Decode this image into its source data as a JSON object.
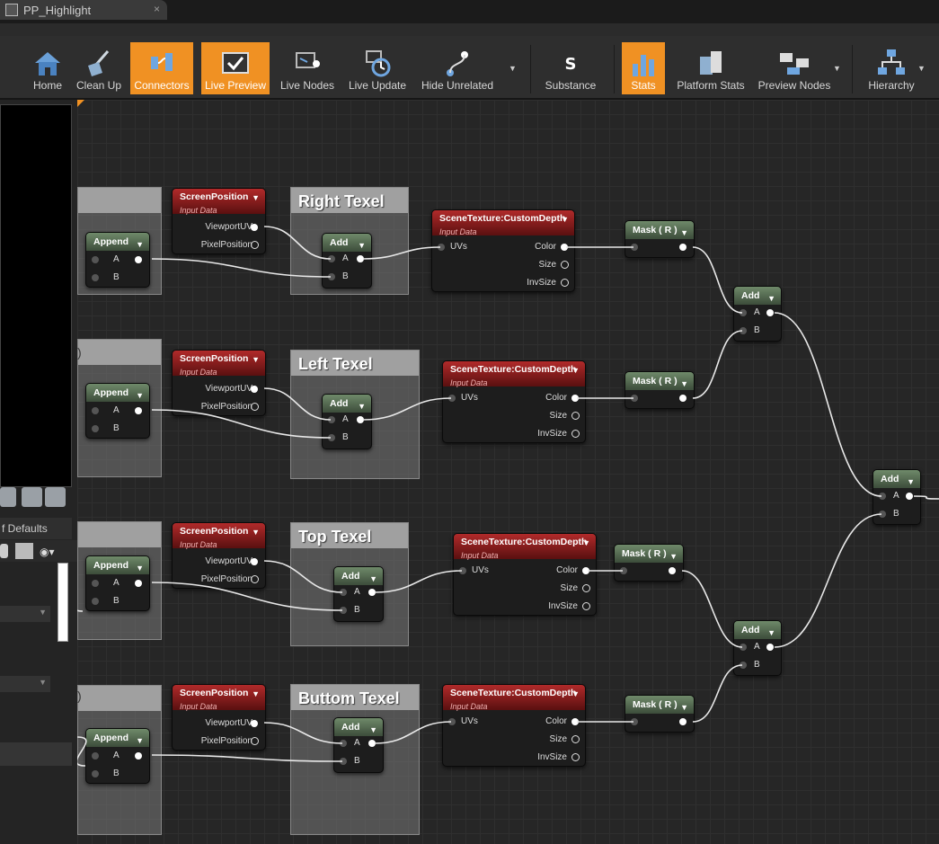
{
  "tab": {
    "title": "PP_Highlight",
    "close": "×"
  },
  "toolbar": {
    "buttons": [
      {
        "label": "Home"
      },
      {
        "label": "Clean Up"
      },
      {
        "label": "Connectors"
      },
      {
        "label": "Live Preview"
      },
      {
        "label": "Live Nodes"
      },
      {
        "label": "Live Update"
      },
      {
        "label": "Hide Unrelated"
      },
      {
        "label": "Substance"
      },
      {
        "label": "Stats"
      },
      {
        "label": "Platform Stats"
      },
      {
        "label": "Preview Nodes"
      },
      {
        "label": "Hierarchy"
      }
    ]
  },
  "left": {
    "details_tab": "f Defaults"
  },
  "graph": {
    "comments": [
      "Right Texel",
      "Left Texel",
      "Top Texel",
      "Buttom Texel"
    ],
    "screen_position": {
      "title": "ScreenPosition",
      "sub": "Input Data",
      "out1": "ViewportUV",
      "out2": "PixelPosition"
    },
    "scene_texture": {
      "title": "SceneTexture:CustomDepth",
      "sub": "Input Data",
      "in": "UVs",
      "out1": "Color",
      "out2": "Size",
      "out3": "InvSize"
    },
    "append": {
      "title": "Append",
      "a": "A",
      "b": "B"
    },
    "add": {
      "title": "Add",
      "a": "A",
      "b": "B"
    },
    "mask": {
      "title": "Mask ( R )"
    }
  },
  "colors": {
    "accent": "#f09123",
    "graph_bg": "#262626",
    "red_header": "#b12a2a",
    "green_header": "#6f8a6a"
  }
}
